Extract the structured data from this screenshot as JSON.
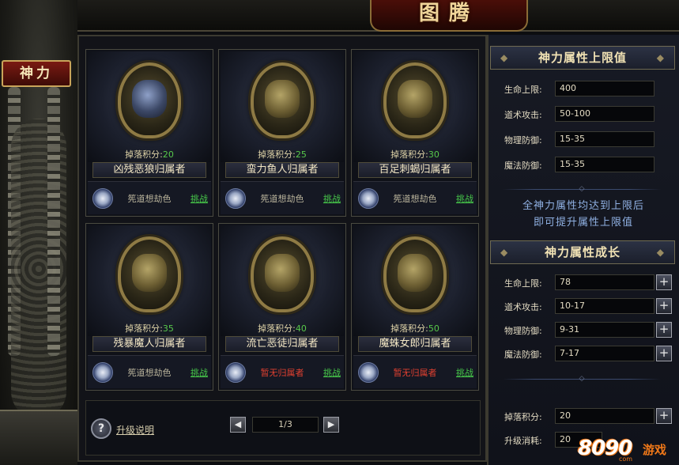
{
  "title": "图腾",
  "side_tab": "神力",
  "cards": [
    {
      "points_label": "掉落积分:",
      "points": "20",
      "name": "凶残恶狼归属者",
      "owner": "筅道想劫色",
      "owner_none": false,
      "challenge": "挑战"
    },
    {
      "points_label": "掉落积分:",
      "points": "25",
      "name": "蛮力鱼人归属者",
      "owner": "筅道想劫色",
      "owner_none": false,
      "challenge": "挑战"
    },
    {
      "points_label": "掉落积分:",
      "points": "30",
      "name": "百足刺蝎归属者",
      "owner": "筅道想劫色",
      "owner_none": false,
      "challenge": "挑战"
    },
    {
      "points_label": "掉落积分:",
      "points": "35",
      "name": "残暴魔人归属者",
      "owner": "筅道想劫色",
      "owner_none": false,
      "challenge": "挑战"
    },
    {
      "points_label": "掉落积分:",
      "points": "40",
      "name": "流亡恶徒归属者",
      "owner": "暂无归属者",
      "owner_none": true,
      "challenge": "挑战"
    },
    {
      "points_label": "掉落积分:",
      "points": "50",
      "name": "魔蛛女郎归属者",
      "owner": "暂无归属者",
      "owner_none": true,
      "challenge": "挑战"
    }
  ],
  "help": {
    "icon": "?",
    "label": "升级说明"
  },
  "pager": {
    "prev": "◀",
    "value": "1/3",
    "next": "▶"
  },
  "panel": {
    "cap_title": "神力属性上限值",
    "cap_rows": [
      {
        "label": "生命上限:",
        "value": "400"
      },
      {
        "label": "道术攻击:",
        "value": "50-100"
      },
      {
        "label": "物理防御:",
        "value": "15-35"
      },
      {
        "label": "魔法防御:",
        "value": "15-35"
      }
    ],
    "note_line1": "全神力属性均达到上限后",
    "note_line2": "即可提升属性上限值",
    "growth_title": "神力属性成长",
    "growth_rows": [
      {
        "label": "生命上限:",
        "value": "78"
      },
      {
        "label": "道术攻击:",
        "value": "10-17"
      },
      {
        "label": "物理防御:",
        "value": "9-31"
      },
      {
        "label": "魔法防御:",
        "value": "7-17"
      }
    ],
    "drop_points": {
      "label": "掉落积分:",
      "value": "20"
    },
    "upgrade_cost": {
      "label": "升级消耗:",
      "value": "20"
    },
    "plus": "+"
  },
  "watermark": {
    "number": "8090",
    "word": "游戏",
    "domain": "com"
  },
  "colors": {
    "points": "#57c84a",
    "challenge": "#47c94a",
    "no_owner": "#e04030",
    "note": "#8fb0e2"
  }
}
